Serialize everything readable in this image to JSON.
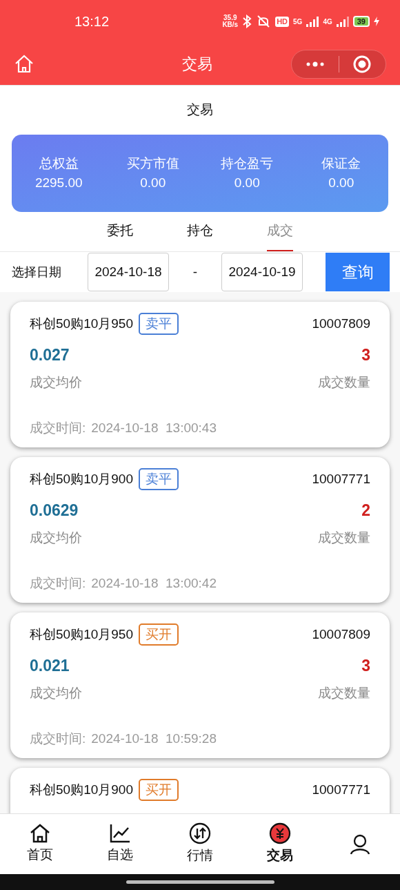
{
  "status_bar": {
    "time": "13:12",
    "net_speed_value": "35.9",
    "net_speed_unit": "KB/s",
    "hd": "HD",
    "network_1": "5G",
    "network_2": "4G",
    "battery": "39"
  },
  "header": {
    "title": "交易"
  },
  "page_title": "交易",
  "summary": [
    {
      "label": "总权益",
      "value": "2295.00"
    },
    {
      "label": "买方市值",
      "value": "0.00"
    },
    {
      "label": "持仓盈亏",
      "value": "0.00"
    },
    {
      "label": "保证金",
      "value": "0.00"
    }
  ],
  "tabs": [
    {
      "label": "委托",
      "selected": false
    },
    {
      "label": "持仓",
      "selected": false
    },
    {
      "label": "成交",
      "selected": true
    }
  ],
  "date_filter": {
    "label": "选择日期",
    "start": "2024-10-18",
    "separator": "-",
    "end": "2024-10-19",
    "button": "查询"
  },
  "trades": [
    {
      "name": "科创50购10月950",
      "tag": "卖平",
      "kind": "sell_close",
      "code": "10007809",
      "price": "0.027",
      "quantity": "3",
      "price_label": "成交均价",
      "quantity_label": "成交数量",
      "time_label": "成交时间:",
      "time": "2024-10-18  13:00:43"
    },
    {
      "name": "科创50购10月900",
      "tag": "卖平",
      "kind": "sell_close",
      "code": "10007771",
      "price": "0.0629",
      "quantity": "2",
      "price_label": "成交均价",
      "quantity_label": "成交数量",
      "time_label": "成交时间:",
      "time": "2024-10-18  13:00:42"
    },
    {
      "name": "科创50购10月950",
      "tag": "买开",
      "kind": "buy_open",
      "code": "10007809",
      "price": "0.021",
      "quantity": "3",
      "price_label": "成交均价",
      "quantity_label": "成交数量",
      "time_label": "成交时间:",
      "time": "2024-10-18  10:59:28"
    },
    {
      "name": "科创50购10月900",
      "tag": "买开",
      "kind": "buy_open",
      "code": "10007771"
    }
  ],
  "bottom_nav": [
    {
      "label": "首页",
      "kind": "home",
      "selected": false
    },
    {
      "label": "自选",
      "kind": "chart",
      "selected": false
    },
    {
      "label": "行情",
      "kind": "exchange",
      "selected": false
    },
    {
      "label": "交易",
      "kind": "trade",
      "selected": true
    },
    {
      "kind": "profile",
      "selected": false
    }
  ]
}
